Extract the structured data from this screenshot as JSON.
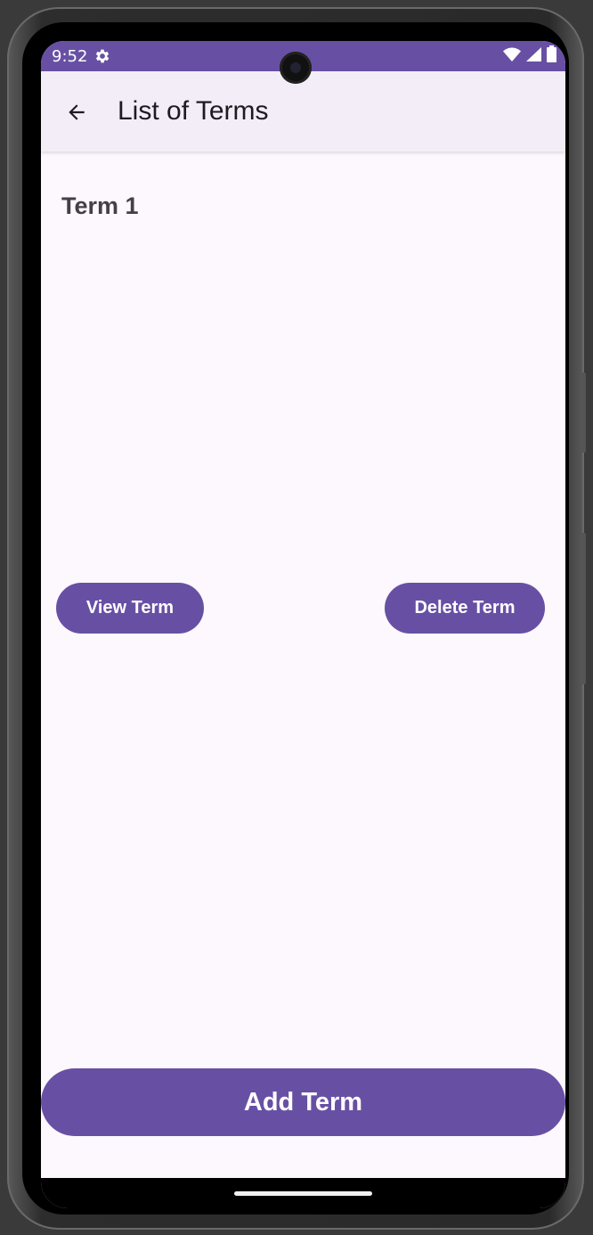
{
  "status_bar": {
    "time": "9:52",
    "settings_icon": "gear-icon",
    "wifi_icon": "wifi-icon",
    "signal_icon": "signal-icon",
    "battery_icon": "battery-icon",
    "color": "#6750a4"
  },
  "app_bar": {
    "back_icon": "arrow-back-icon",
    "title": "List of Terms",
    "background": "#f3edf7"
  },
  "terms": [
    {
      "title": "Term 1",
      "view_label": "View Term",
      "delete_label": "Delete Term"
    }
  ],
  "footer": {
    "add_label": "Add Term"
  },
  "colors": {
    "primary": "#6750a4",
    "surface": "#fdf8fd",
    "on_primary": "#ffffff",
    "title_text": "#444047"
  }
}
